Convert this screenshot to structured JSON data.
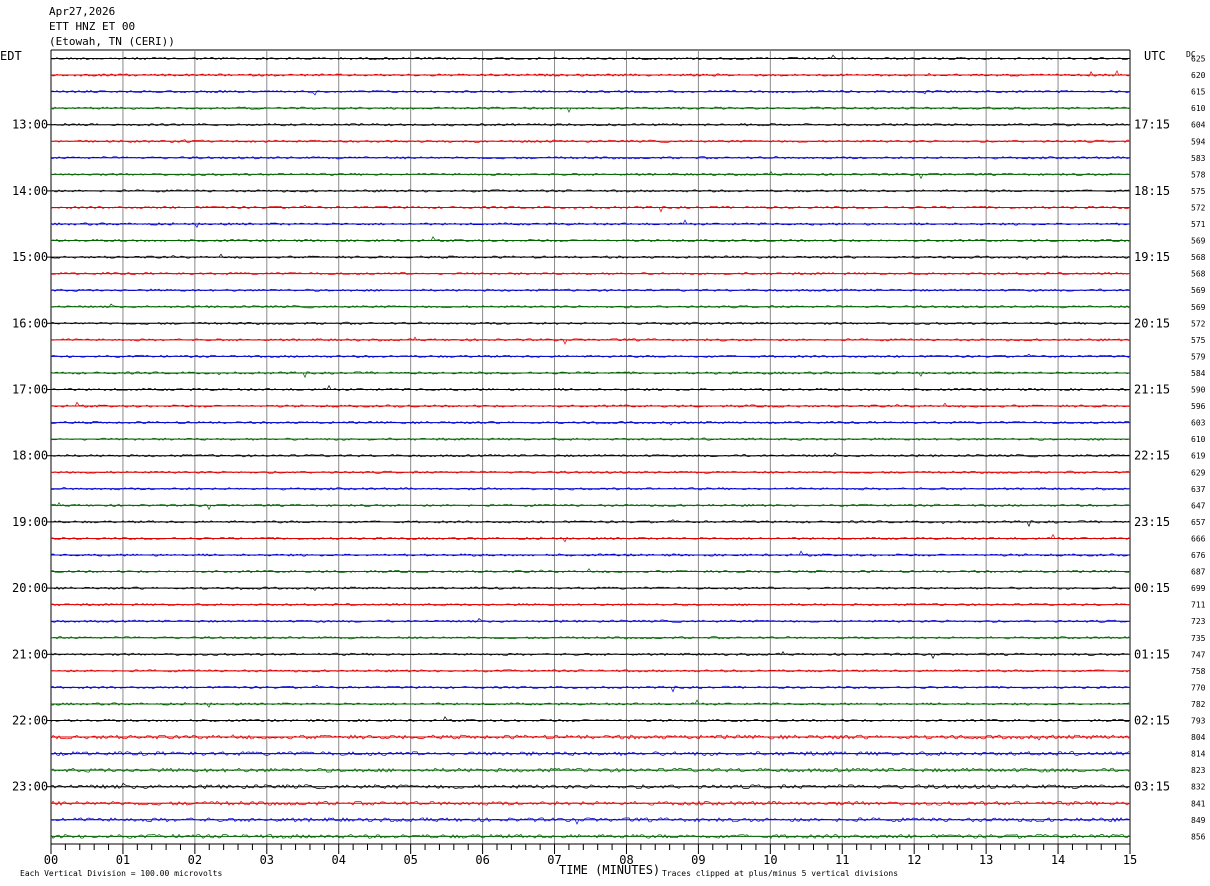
{
  "header": {
    "date": "Apr27,2026",
    "channel": "ETT HNZ ET 00",
    "station": "(Etowah, TN (CERI))"
  },
  "chart_data": {
    "type": "line",
    "title": "Apr27,2026 ETT HNZ ET 00 (Etowah, TN (CERI))",
    "left_axis_label": "EDT",
    "right_axis_label": "UTC",
    "dc_label": "DC",
    "xlabel": "TIME (MINUTES)",
    "xlim": [
      0,
      15
    ],
    "x_ticks": [
      "00",
      "01",
      "02",
      "03",
      "04",
      "05",
      "06",
      "07",
      "08",
      "09",
      "10",
      "11",
      "12",
      "13",
      "14",
      "15"
    ],
    "left_hour_labels": [
      "13:00",
      "14:00",
      "15:00",
      "16:00",
      "17:00",
      "18:00",
      "19:00",
      "20:00",
      "21:00",
      "22:00",
      "23:00"
    ],
    "right_hour_labels": [
      "17:15",
      "18:15",
      "19:15",
      "20:15",
      "21:15",
      "22:15",
      "23:15",
      "00:15",
      "01:15",
      "02:15",
      "03:15"
    ],
    "trace_colors": [
      "#000000",
      "#e00000",
      "#0000d0",
      "#006400"
    ],
    "dc_offsets": [
      625,
      620,
      615,
      610,
      604,
      594,
      583,
      578,
      575,
      572,
      571,
      569,
      568,
      568,
      569,
      569,
      572,
      575,
      579,
      584,
      590,
      596,
      603,
      610,
      619,
      629,
      637,
      647,
      657,
      666,
      676,
      687,
      699,
      711,
      723,
      735,
      747,
      758,
      770,
      782,
      793,
      804,
      814,
      823,
      832,
      841,
      849,
      856
    ],
    "vertical_division": "Each Vertical Division =  100.00 microvolts",
    "clip_note": "Traces clipped at plus/minus 5 vertical divisions",
    "trace_count": 48,
    "minutes_per_trace": 15
  }
}
